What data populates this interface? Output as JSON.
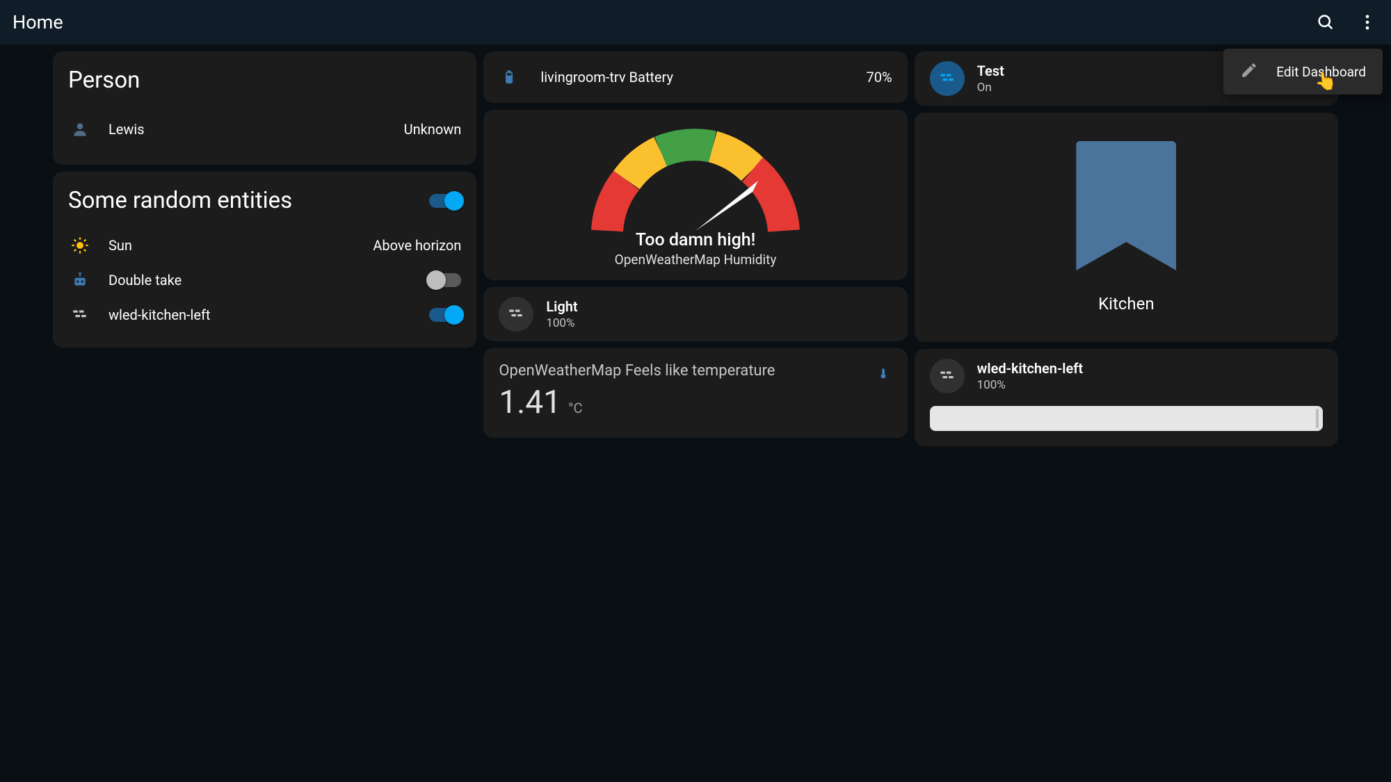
{
  "header": {
    "title": "Home"
  },
  "menu": {
    "edit_label": "Edit Dashboard"
  },
  "col1": {
    "person_card": {
      "title": "Person",
      "rows": [
        {
          "label": "Lewis",
          "value": "Unknown"
        }
      ]
    },
    "entities_card": {
      "title": "Some random entities",
      "header_toggle": true,
      "rows": [
        {
          "icon": "sun",
          "label": "Sun",
          "value": "Above horizon"
        },
        {
          "icon": "robot",
          "label": "Double take",
          "toggle": false
        },
        {
          "icon": "wled",
          "label": "wled-kitchen-left",
          "toggle": true
        }
      ]
    }
  },
  "col2": {
    "battery": {
      "label": "livingroom-trv Battery",
      "value": "70%"
    },
    "gauge": {
      "caption": "Too damn high!",
      "sub": "OpenWeatherMap Humidity"
    },
    "light": {
      "name": "Light",
      "sub": "100%"
    },
    "temperature": {
      "title": "OpenWeatherMap Feels like temperature",
      "value": "1.41",
      "unit": "°C"
    }
  },
  "col3": {
    "test": {
      "name": "Test",
      "sub": "On"
    },
    "area": {
      "label": "Kitchen"
    },
    "wled": {
      "name": "wled-kitchen-left",
      "sub": "100%"
    }
  }
}
